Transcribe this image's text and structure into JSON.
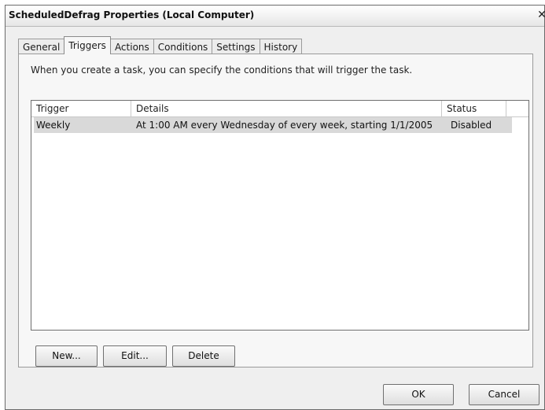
{
  "window": {
    "title": "ScheduledDefrag Properties (Local Computer)",
    "close_glyph": "✕"
  },
  "tabs": [
    {
      "label": "General",
      "active": false
    },
    {
      "label": "Triggers",
      "active": true
    },
    {
      "label": "Actions",
      "active": false
    },
    {
      "label": "Conditions",
      "active": false
    },
    {
      "label": "Settings",
      "active": false
    },
    {
      "label": "History",
      "active": false
    }
  ],
  "triggers_panel": {
    "description": "When you create a task, you can specify the conditions that will trigger the task.",
    "columns": [
      "Trigger",
      "Details",
      "Status"
    ],
    "rows": [
      {
        "trigger": "Weekly",
        "details": "At 1:00 AM every Wednesday of every week, starting 1/1/2005",
        "status": "Disabled"
      }
    ],
    "buttons": {
      "new": "New...",
      "edit": "Edit...",
      "delete": "Delete"
    }
  },
  "footer": {
    "ok": "OK",
    "cancel": "Cancel"
  },
  "colors": {
    "selection": "#d9d9d9",
    "dialog_bg": "#efefef"
  }
}
